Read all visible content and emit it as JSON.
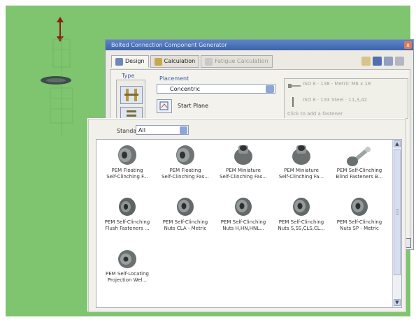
{
  "dialog": {
    "title": "Bolted Connection Component Generator",
    "close": "x",
    "tabs": [
      {
        "label": "Design"
      },
      {
        "label": "Calculation"
      },
      {
        "label": "Fatigue Calculation"
      }
    ],
    "type_label": "Type",
    "placement_label": "Placement",
    "placement_value": "Concentric",
    "start_plane": "Start Plane",
    "right_list": [
      "ISO 8 · 138 · Metric M6 x 18",
      "ISO 8 · 133 Steel · 11,3,42",
      "Click to add a fastener"
    ]
  },
  "popup": {
    "standard_label": "Standard",
    "standard_value": "All",
    "items": [
      {
        "line1": "PEM Floating",
        "line2": "Self-Clinching F...",
        "icon": "floating-nut-icon"
      },
      {
        "line1": "PEM Floating",
        "line2": "Self-Clinching Fas...",
        "icon": "floating-nut-icon"
      },
      {
        "line1": "PEM Miniature",
        "line2": "Self-Clinching Fas...",
        "icon": "miniature-nut-icon"
      },
      {
        "line1": "PEM Miniature",
        "line2": "Self-Clinching Fa...",
        "icon": "miniature-nut-icon"
      },
      {
        "line1": "PEM Self-Clinching",
        "line2": "Blind Fasteners B...",
        "icon": "blind-fastener-icon"
      },
      {
        "line1": "PEM Self-Clinching",
        "line2": "Flush Fasteners ...",
        "icon": "flush-nut-icon"
      },
      {
        "line1": "PEM Self-Clinching",
        "line2": "Nuts CLA - Metric",
        "icon": "clinch-nut-icon"
      },
      {
        "line1": "PEM Self-Clinching",
        "line2": "Nuts H,HN,HNL...",
        "icon": "clinch-nut-icon"
      },
      {
        "line1": "PEM Self-Clinching",
        "line2": "Nuts S,SS,CLS,CL...",
        "icon": "clinch-nut-icon"
      },
      {
        "line1": "PEM Self-Clinching",
        "line2": "Nuts SP - Metric",
        "icon": "clinch-nut-icon"
      },
      {
        "line1": "PEM Self-Locating",
        "line2": "Projection Wel...",
        "icon": "weld-nut-icon"
      }
    ]
  },
  "colors": {
    "viewport_green": "#7fc46f",
    "titlebar_blue": "#4a70b5",
    "arrow_red": "#8a1f14"
  }
}
